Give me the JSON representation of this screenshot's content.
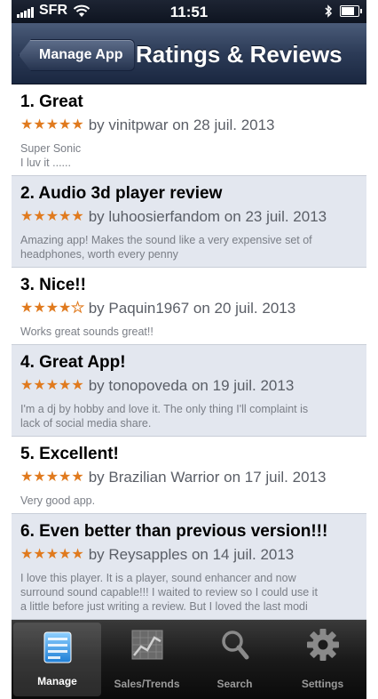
{
  "status_bar": {
    "carrier": "SFR",
    "time": "11:51"
  },
  "nav": {
    "back_label": "Manage App",
    "title": "Ratings & Reviews"
  },
  "colors": {
    "star": "#e07a1e",
    "nav_bar": "#2c3b57",
    "row_alt": "#e3e7ef"
  },
  "reviews": [
    {
      "title": "1. Great",
      "rating": 5,
      "meta": "by vinitpwar on 28 juil. 2013",
      "body_lines": [
        "Super Sonic",
        "I luv it ......"
      ]
    },
    {
      "title": "2. Audio 3d player review",
      "rating": 5,
      "meta": "by luhoosierfandom on 23 juil. 2013",
      "body_lines": [
        "Amazing app! Makes the sound like a very expensive set of",
        "headphones, worth every penny"
      ]
    },
    {
      "title": "3. Nice!!",
      "rating": 4,
      "meta": "by Paquin1967 on 20 juil. 2013",
      "body_lines": [
        "Works great sounds great!!"
      ]
    },
    {
      "title": "4. Great App!",
      "rating": 5,
      "meta": "by tonopoveda on 19 juil. 2013",
      "body_lines": [
        "I'm a dj by hobby and love it. The only thing I'll complaint is",
        "lack of social media share."
      ]
    },
    {
      "title": "5. Excellent!",
      "rating": 5,
      "meta": "by Brazilian Warrior on 17 juil. 2013",
      "body_lines": [
        "Very good app."
      ]
    },
    {
      "title": "6. Even better than previous version!!!",
      "rating": 5,
      "meta": "by Reysapples on 14 juil. 2013",
      "body_lines": [
        "I love this player. It is a player, sound enhancer and now",
        "surround sound capable!!! I waited to review so I could use it",
        "a little before just writing a review. But I loved the last modi"
      ]
    }
  ],
  "tabs": [
    {
      "label": "Manage",
      "icon": "manage-icon",
      "active": true
    },
    {
      "label": "Sales/Trends",
      "icon": "chart-icon",
      "active": false
    },
    {
      "label": "Search",
      "icon": "search-icon",
      "active": false
    },
    {
      "label": "Settings",
      "icon": "gear-icon",
      "active": false
    }
  ]
}
